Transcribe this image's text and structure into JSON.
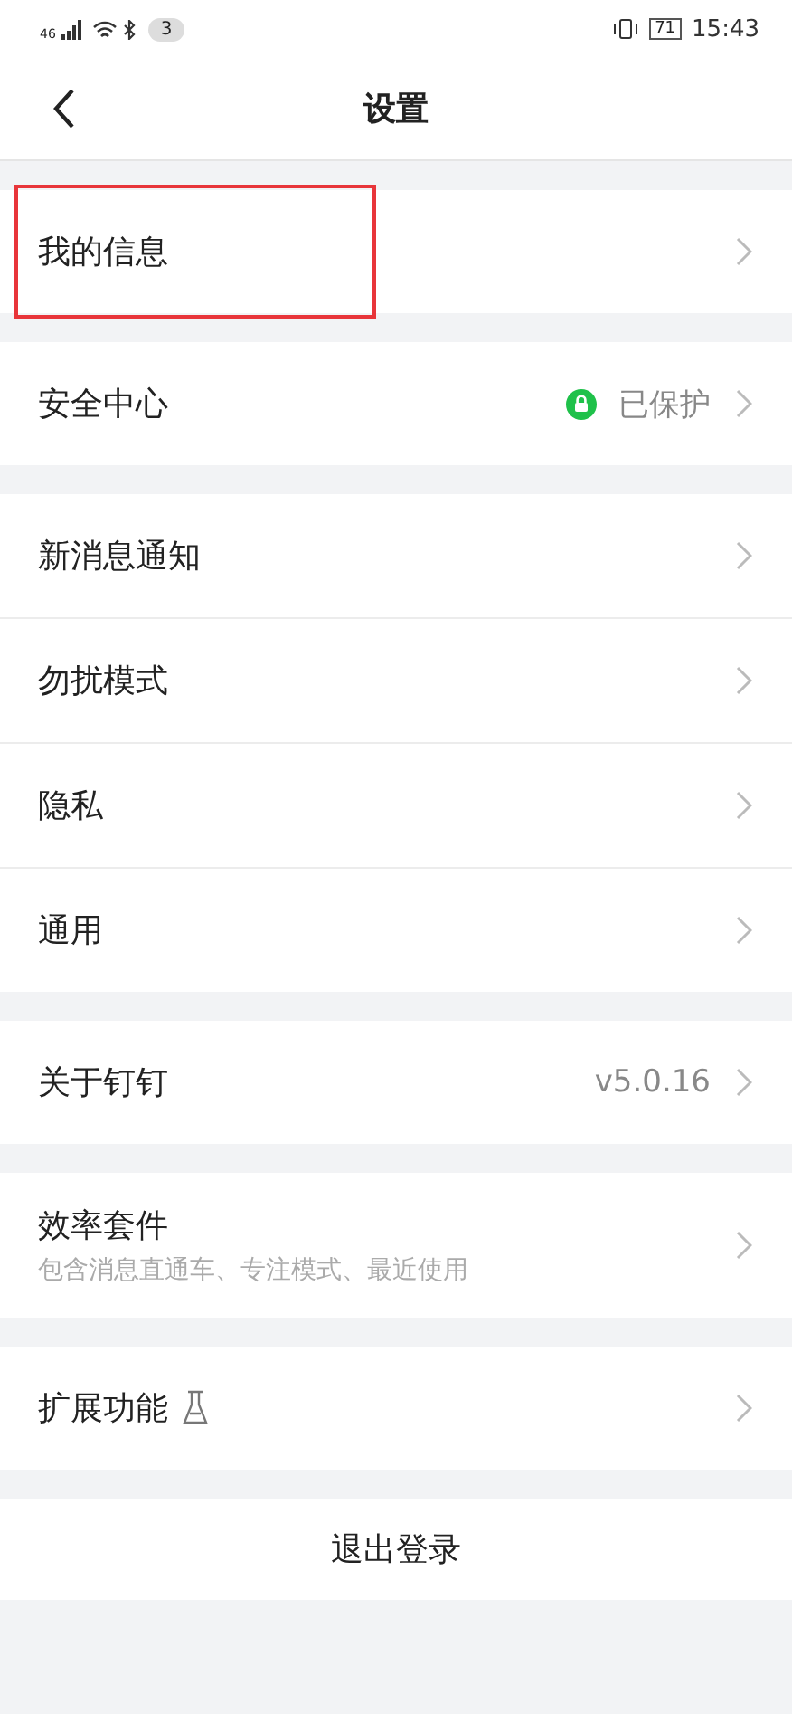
{
  "status_bar": {
    "network": "46",
    "notifications": "3",
    "battery": "71",
    "time": "15:43"
  },
  "header": {
    "title": "设置"
  },
  "groups": [
    {
      "items": [
        {
          "kind": "plain",
          "label": "我的信息",
          "highlighted": true
        }
      ]
    },
    {
      "items": [
        {
          "kind": "status",
          "label": "安全中心",
          "value": "已保护",
          "highlighted": false
        }
      ]
    },
    {
      "items": [
        {
          "kind": "plain",
          "label": "新消息通知",
          "highlighted": false
        },
        {
          "kind": "plain",
          "label": "勿扰模式",
          "highlighted": false
        },
        {
          "kind": "plain",
          "label": "隐私",
          "highlighted": false
        },
        {
          "kind": "plain",
          "label": "通用",
          "highlighted": false
        }
      ]
    },
    {
      "items": [
        {
          "kind": "version",
          "label": "关于钉钉",
          "value": "v5.0.16",
          "highlighted": false
        }
      ]
    },
    {
      "items": [
        {
          "kind": "subtitle",
          "label": "效率套件",
          "subtitle": "包含消息直通车、专注模式、最近使用",
          "highlighted": false
        }
      ]
    },
    {
      "items": [
        {
          "kind": "lab",
          "label": "扩展功能",
          "highlighted": false
        }
      ]
    }
  ],
  "logout": {
    "label": "退出登录"
  }
}
